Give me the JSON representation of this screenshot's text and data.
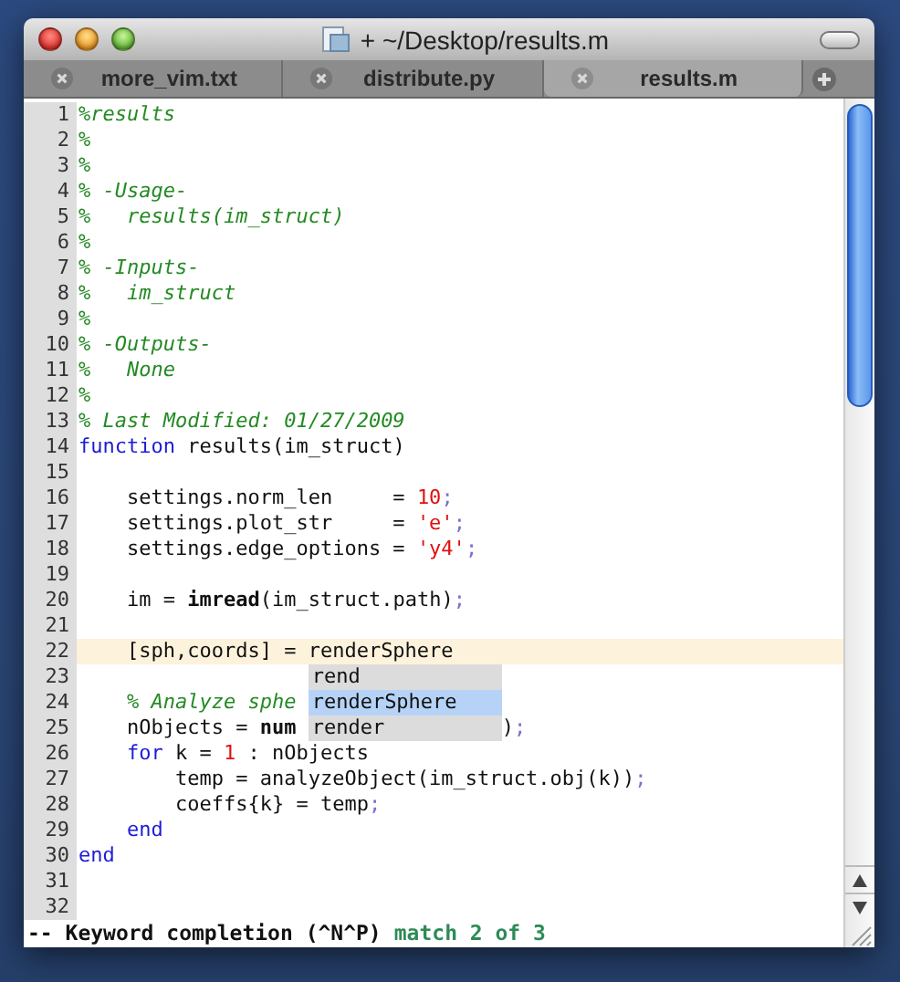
{
  "window": {
    "title": "+ ~/Desktop/results.m"
  },
  "tabs": [
    {
      "label": "more_vim.txt",
      "selected": false
    },
    {
      "label": "distribute.py",
      "selected": false
    },
    {
      "label": "results.m",
      "selected": true
    }
  ],
  "lines": [
    {
      "number": "1",
      "current": false,
      "tokens": [
        {
          "text": "%results",
          "kind": "comment"
        }
      ]
    },
    {
      "number": "2",
      "current": false,
      "tokens": [
        {
          "text": "%",
          "kind": "comment"
        }
      ]
    },
    {
      "number": "3",
      "current": false,
      "tokens": [
        {
          "text": "%",
          "kind": "comment"
        }
      ]
    },
    {
      "number": "4",
      "current": false,
      "tokens": [
        {
          "text": "% -Usage-",
          "kind": "comment"
        }
      ]
    },
    {
      "number": "5",
      "current": false,
      "tokens": [
        {
          "text": "%   results(im_struct)",
          "kind": "comment"
        }
      ]
    },
    {
      "number": "6",
      "current": false,
      "tokens": [
        {
          "text": "%",
          "kind": "comment"
        }
      ]
    },
    {
      "number": "7",
      "current": false,
      "tokens": [
        {
          "text": "% -Inputs-",
          "kind": "comment"
        }
      ]
    },
    {
      "number": "8",
      "current": false,
      "tokens": [
        {
          "text": "%   im_struct",
          "kind": "comment"
        }
      ]
    },
    {
      "number": "9",
      "current": false,
      "tokens": [
        {
          "text": "%",
          "kind": "comment"
        }
      ]
    },
    {
      "number": "10",
      "current": false,
      "tokens": [
        {
          "text": "% -Outputs-",
          "kind": "comment"
        }
      ]
    },
    {
      "number": "11",
      "current": false,
      "tokens": [
        {
          "text": "%   None",
          "kind": "comment"
        }
      ]
    },
    {
      "number": "12",
      "current": false,
      "tokens": [
        {
          "text": "%",
          "kind": "comment"
        }
      ]
    },
    {
      "number": "13",
      "current": false,
      "tokens": [
        {
          "text": "% Last Modified: 01/27/2009",
          "kind": "comment"
        }
      ]
    },
    {
      "number": "14",
      "current": false,
      "tokens": [
        {
          "text": "function",
          "kind": "keyword"
        },
        {
          "text": " results(im_struct)",
          "kind": "plain"
        }
      ]
    },
    {
      "number": "15",
      "current": false
    },
    {
      "number": "16",
      "current": false,
      "tokens": [
        {
          "text": "    settings.norm_len     = ",
          "kind": "plain"
        },
        {
          "text": "10",
          "kind": "number"
        },
        {
          "text": ";",
          "kind": "punct"
        }
      ]
    },
    {
      "number": "17",
      "current": false,
      "tokens": [
        {
          "text": "    settings.plot_str     = ",
          "kind": "plain"
        },
        {
          "text": "'e'",
          "kind": "string"
        },
        {
          "text": ";",
          "kind": "punct"
        }
      ]
    },
    {
      "number": "18",
      "current": false,
      "tokens": [
        {
          "text": "    settings.edge_options = ",
          "kind": "plain"
        },
        {
          "text": "'y4'",
          "kind": "string"
        },
        {
          "text": ";",
          "kind": "punct"
        }
      ]
    },
    {
      "number": "19",
      "current": false
    },
    {
      "number": "20",
      "current": false,
      "tokens": [
        {
          "text": "    im = ",
          "kind": "plain"
        },
        {
          "text": "imread",
          "kind": "builtin"
        },
        {
          "text": "(im_struct.path)",
          "kind": "plain"
        },
        {
          "text": ";",
          "kind": "punct"
        }
      ]
    },
    {
      "number": "21",
      "current": false
    },
    {
      "number": "22",
      "current": true,
      "tokens": [
        {
          "text": "    [sph,coords] = ",
          "kind": "plain"
        },
        {
          "text": "renderSphere",
          "kind": "plain"
        }
      ]
    },
    {
      "number": "23",
      "current": false
    },
    {
      "number": "24",
      "current": false,
      "tokens": [
        {
          "text": "    % Analyze sphe",
          "kind": "comment"
        }
      ]
    },
    {
      "number": "25",
      "current": false,
      "tokens": [
        {
          "text": "    nObjects = ",
          "kind": "plain"
        },
        {
          "text": "num",
          "kind": "builtin"
        },
        {
          "text": "                 )",
          "kind": "plain"
        },
        {
          "text": ";",
          "kind": "punct"
        }
      ]
    },
    {
      "number": "26",
      "current": false,
      "tokens": [
        {
          "text": "    for",
          "kind": "keyword"
        },
        {
          "text": " k = ",
          "kind": "plain"
        },
        {
          "text": "1",
          "kind": "number"
        },
        {
          "text": " : nObjects",
          "kind": "plain"
        }
      ]
    },
    {
      "number": "27",
      "current": false,
      "tokens": [
        {
          "text": "        temp = analyzeObject(im_struct.obj(k))",
          "kind": "plain"
        },
        {
          "text": ";",
          "kind": "punct"
        }
      ]
    },
    {
      "number": "28",
      "current": false,
      "tokens": [
        {
          "text": "        coeffs{k} = temp",
          "kind": "plain"
        },
        {
          "text": ";",
          "kind": "punct"
        }
      ]
    },
    {
      "number": "29",
      "current": false,
      "tokens": [
        {
          "text": "    end",
          "kind": "keyword"
        }
      ]
    },
    {
      "number": "30",
      "current": false,
      "tokens": [
        {
          "text": "end",
          "kind": "keyword"
        }
      ]
    },
    {
      "number": "31",
      "current": false
    },
    {
      "number": "32",
      "current": false
    }
  ],
  "completion_menu": {
    "items": [
      {
        "label": "rend",
        "selected": false
      },
      {
        "label": "renderSphere",
        "selected": true
      },
      {
        "label": "render",
        "selected": false
      }
    ]
  },
  "status_bar": {
    "mode": "-- Keyword completion (^N^P)",
    "match": "match 2 of 3"
  }
}
